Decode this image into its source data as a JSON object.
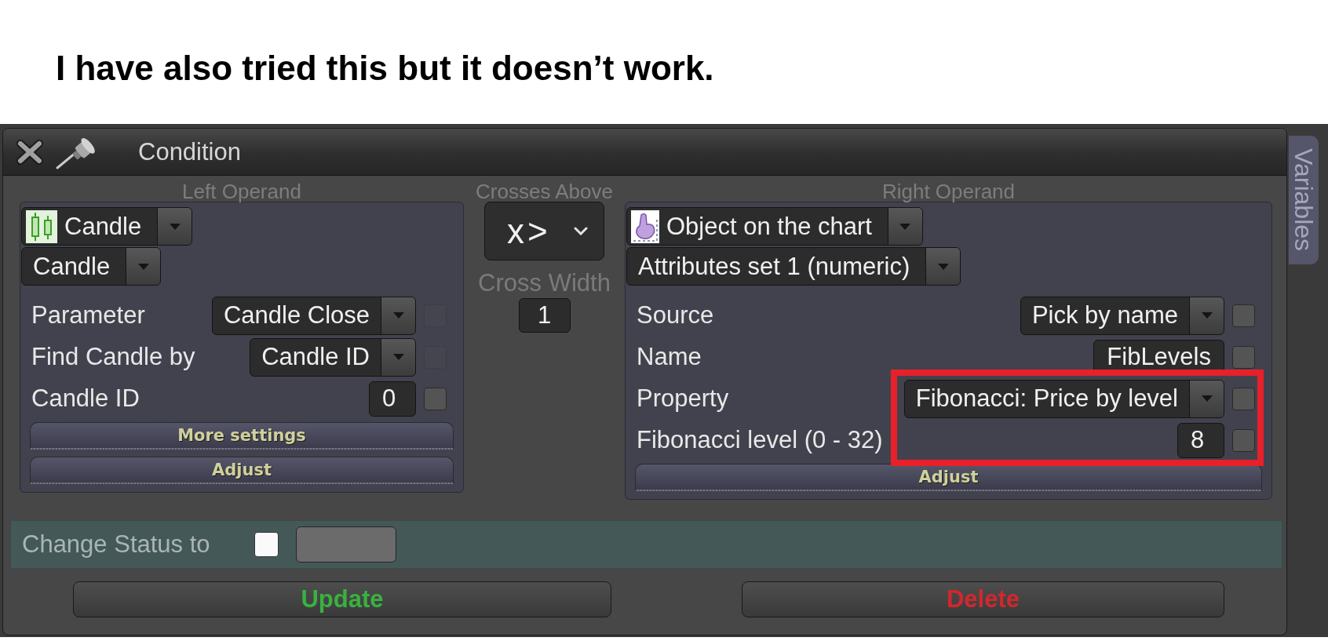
{
  "caption": "I have also tried this but it doesn’t work.",
  "window": {
    "title": "Condition"
  },
  "side_tab": {
    "label": "Variables"
  },
  "left_operand": {
    "heading": "Left Operand",
    "selectors": [
      {
        "kind": "with_icon",
        "value": "Candle"
      },
      {
        "kind": "plain",
        "value": "Candle"
      }
    ],
    "fields": [
      {
        "label": "Parameter",
        "kind": "dropdown",
        "value": "Candle Close",
        "checkbox": {
          "checked": false,
          "disabled": true
        }
      },
      {
        "label": "Find Candle by",
        "kind": "dropdown",
        "value": "Candle ID",
        "checkbox": {
          "checked": false,
          "disabled": true
        }
      },
      {
        "label": "Candle ID",
        "kind": "input",
        "value": "0",
        "checkbox": {
          "checked": false,
          "disabled": false
        }
      }
    ],
    "buttons": [
      "More settings",
      "Adjust"
    ]
  },
  "operator": {
    "heading": "Crosses Above",
    "symbol": "x>",
    "width_label": "Cross Width",
    "width_value": "1"
  },
  "right_operand": {
    "heading": "Right Operand",
    "selectors": [
      {
        "kind": "with_icon",
        "value": "Object on the chart"
      },
      {
        "kind": "plain",
        "value": "Attributes set 1 (numeric)"
      }
    ],
    "fields": [
      {
        "label": "Source",
        "kind": "dropdown",
        "value": "Pick by name",
        "checkbox": {
          "checked": false,
          "disabled": false
        },
        "highlighted": false
      },
      {
        "label": "Name",
        "kind": "input",
        "value": "FibLevels",
        "checkbox": {
          "checked": false,
          "disabled": false
        },
        "highlighted": false
      },
      {
        "label": "Property",
        "kind": "dropdown",
        "value": "Fibonacci: Price by level",
        "checkbox": {
          "checked": false,
          "disabled": false
        },
        "highlighted": true
      },
      {
        "label": "Fibonacci level (0 - 32)",
        "kind": "input",
        "value": "8",
        "checkbox": {
          "checked": false,
          "disabled": false
        },
        "highlighted": true
      }
    ],
    "buttons": [
      "Adjust"
    ]
  },
  "status": {
    "label": "Change Status to",
    "checked": false
  },
  "actions": [
    {
      "label": "Update",
      "kind": "confirm"
    },
    {
      "label": "Delete",
      "kind": "danger"
    }
  ]
}
